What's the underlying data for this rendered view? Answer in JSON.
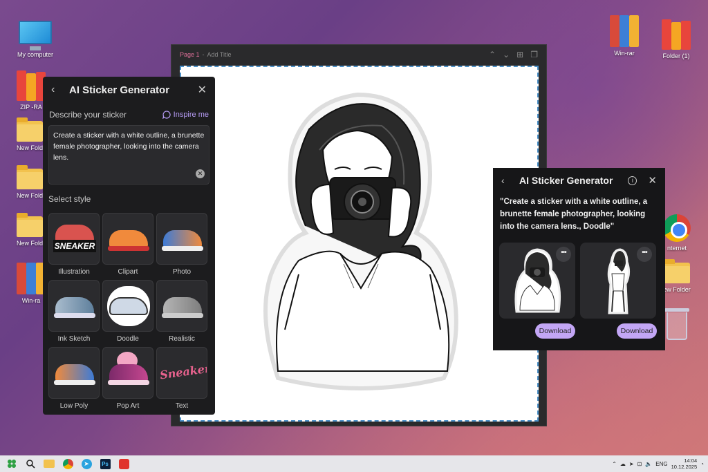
{
  "desktop": {
    "icons_left": [
      {
        "label": "My computer",
        "icon": "monitor-icon"
      },
      {
        "label": "ZIP -RA",
        "icon": "books-icon"
      },
      {
        "label": "New Fold",
        "icon": "folder-icon"
      },
      {
        "label": "New Fold",
        "icon": "folder-icon"
      },
      {
        "label": "New Fold",
        "icon": "folder-icon"
      },
      {
        "label": "Win-ra",
        "icon": "rar-icon"
      }
    ],
    "icons_right": [
      {
        "label": "Win-rar",
        "icon": "rar-icon"
      },
      {
        "label": "Folder (1)",
        "icon": "books-icon"
      },
      {
        "label": "nternet",
        "icon": "chrome-icon"
      },
      {
        "label": "ew Folder",
        "icon": "folder-icon"
      },
      {
        "label": "",
        "icon": "trash-icon"
      }
    ]
  },
  "canvas": {
    "page_label": "Page 1",
    "separator": "-",
    "title_placeholder": "Add Title"
  },
  "left_panel": {
    "back": "‹",
    "title": "AI Sticker Generator",
    "close": "✕",
    "describe_label": "Describe your sticker",
    "inspire_label": "Inspire me",
    "prompt_text": "Create a sticker with a white outline, a brunette female photographer, looking into the camera lens.",
    "select_style_label": "Select style",
    "styles": [
      {
        "name": "Illustration"
      },
      {
        "name": "Clipart"
      },
      {
        "name": "Photo"
      },
      {
        "name": "Ink Sketch"
      },
      {
        "name": "Doodle"
      },
      {
        "name": "Realistic"
      },
      {
        "name": "Low Poly"
      },
      {
        "name": "Pop Art"
      },
      {
        "name": "Text"
      }
    ],
    "illustration_word": "SNEAKER",
    "text_word": "Sneaker"
  },
  "right_panel": {
    "back": "‹",
    "title": "AI Sticker Generator",
    "info": "i",
    "close": "✕",
    "prompt_echo": "\"Create a sticker with a white outline, a brunette female photographer, looking into the camera lens., Doodle\"",
    "more": "•••",
    "download_label": "Download"
  },
  "taskbar": {
    "apps": [
      "windows-icon",
      "search-icon",
      "file-explorer-icon",
      "chrome-icon",
      "telegram-icon",
      "photoshop-icon",
      "acrobat-icon"
    ],
    "lang": "ENG",
    "time": "14:04",
    "date": "10.12.2025",
    "ps_label": "Ps"
  },
  "colors": {
    "accent": "#c3a6f5",
    "panel_bg": "#1c1c1e",
    "page_label": "#e0709a"
  }
}
